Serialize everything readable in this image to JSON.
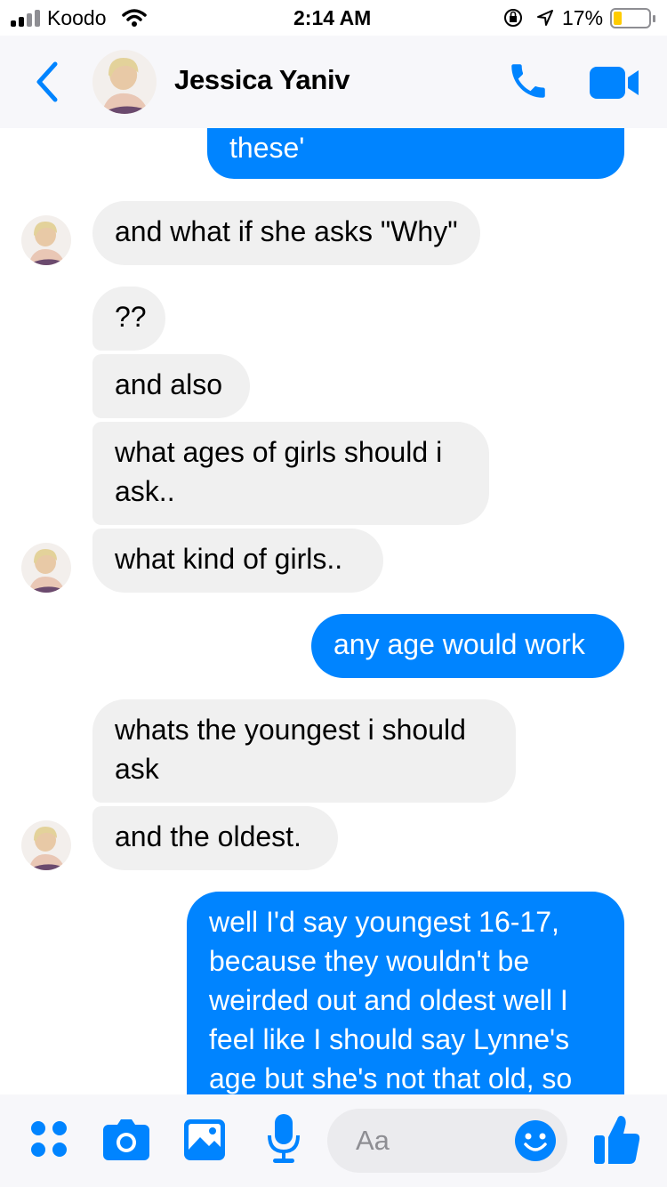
{
  "status_bar": {
    "carrier": "Koodo",
    "time": "2:14 AM",
    "battery": "17%"
  },
  "header": {
    "contact_name": "Jessica Yaniv",
    "back_icon": "chevron-left-icon",
    "call_icon": "phone-icon",
    "video_icon": "video-camera-icon"
  },
  "messages": [
    {
      "from": "me",
      "text": "these'"
    },
    {
      "from": "them",
      "text": "and what if she asks \"Why\""
    },
    {
      "from": "them",
      "text": "??"
    },
    {
      "from": "them",
      "text": "and also"
    },
    {
      "from": "them",
      "text": "what ages of girls should i ask.."
    },
    {
      "from": "them",
      "text": "what kind of girls.."
    },
    {
      "from": "me",
      "text": "any age would work"
    },
    {
      "from": "them",
      "text": "whats the youngest i should ask"
    },
    {
      "from": "them",
      "text": "and the oldest."
    },
    {
      "from": "me",
      "text": "well I'd say youngest 16-17, because they wouldn't be weirded out and oldest well I feel like I should say Lynne's age but she's not that old, so"
    }
  ],
  "composer": {
    "placeholder": "Aa",
    "icons": [
      "apps-icon",
      "camera-icon",
      "gallery-icon",
      "microphone-icon",
      "emoji-icon",
      "thumbs-up-icon"
    ]
  },
  "colors": {
    "accent": "#0084ff",
    "incoming_bubble": "#f0f0f0",
    "outgoing_text": "#ffffff"
  }
}
